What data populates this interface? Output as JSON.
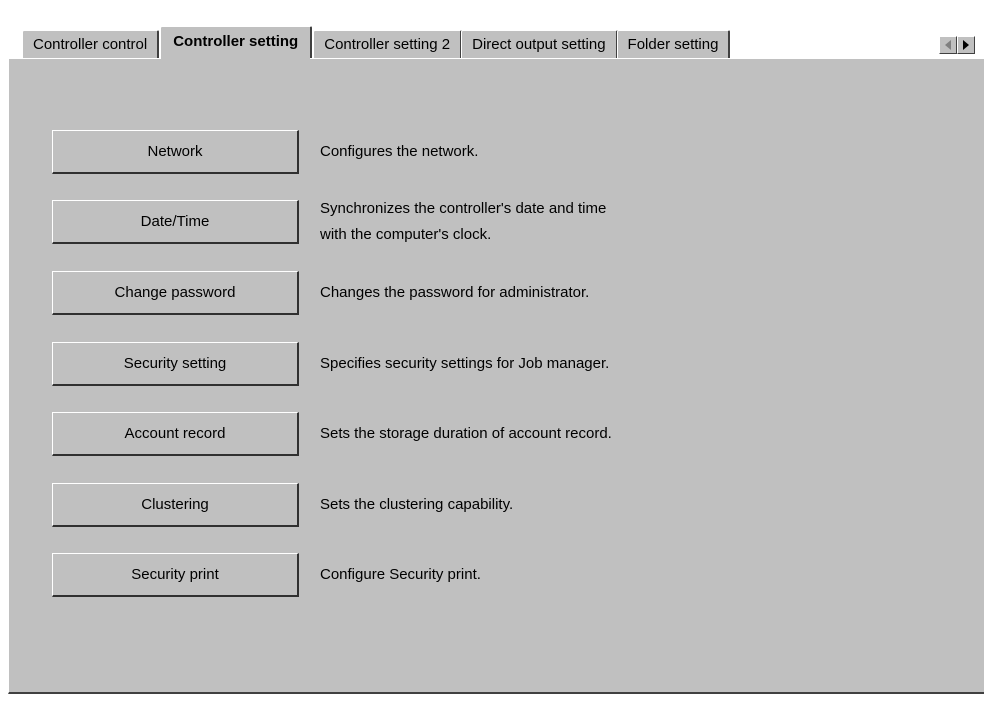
{
  "tabs": [
    {
      "label": "Controller control",
      "active": false
    },
    {
      "label": "Controller setting",
      "active": true
    },
    {
      "label": "Controller setting 2",
      "active": false
    },
    {
      "label": "Direct output setting",
      "active": false
    },
    {
      "label": "Folder setting",
      "active": false
    }
  ],
  "scroll": {
    "left_icon": "arrow-left-icon",
    "right_icon": "arrow-right-icon"
  },
  "settings": [
    {
      "button": "Network",
      "description": [
        "Configures the network."
      ]
    },
    {
      "button": "Date/Time",
      "description": [
        "Synchronizes the controller's date and time",
        "with the computer's clock."
      ]
    },
    {
      "button": "Change password",
      "description": [
        "Changes the password for administrator."
      ]
    },
    {
      "button": "Security setting",
      "description": [
        "Specifies security settings for Job manager."
      ]
    },
    {
      "button": "Account record",
      "description": [
        "Sets the storage duration of account record."
      ]
    },
    {
      "button": "Clustering",
      "description": [
        "Sets the clustering capability."
      ]
    },
    {
      "button": "Security print",
      "description": [
        "Configure Security print."
      ]
    }
  ],
  "colors": {
    "panel": "#c0c0c0",
    "highlight": "#ffffff",
    "shadow": "#404040"
  }
}
